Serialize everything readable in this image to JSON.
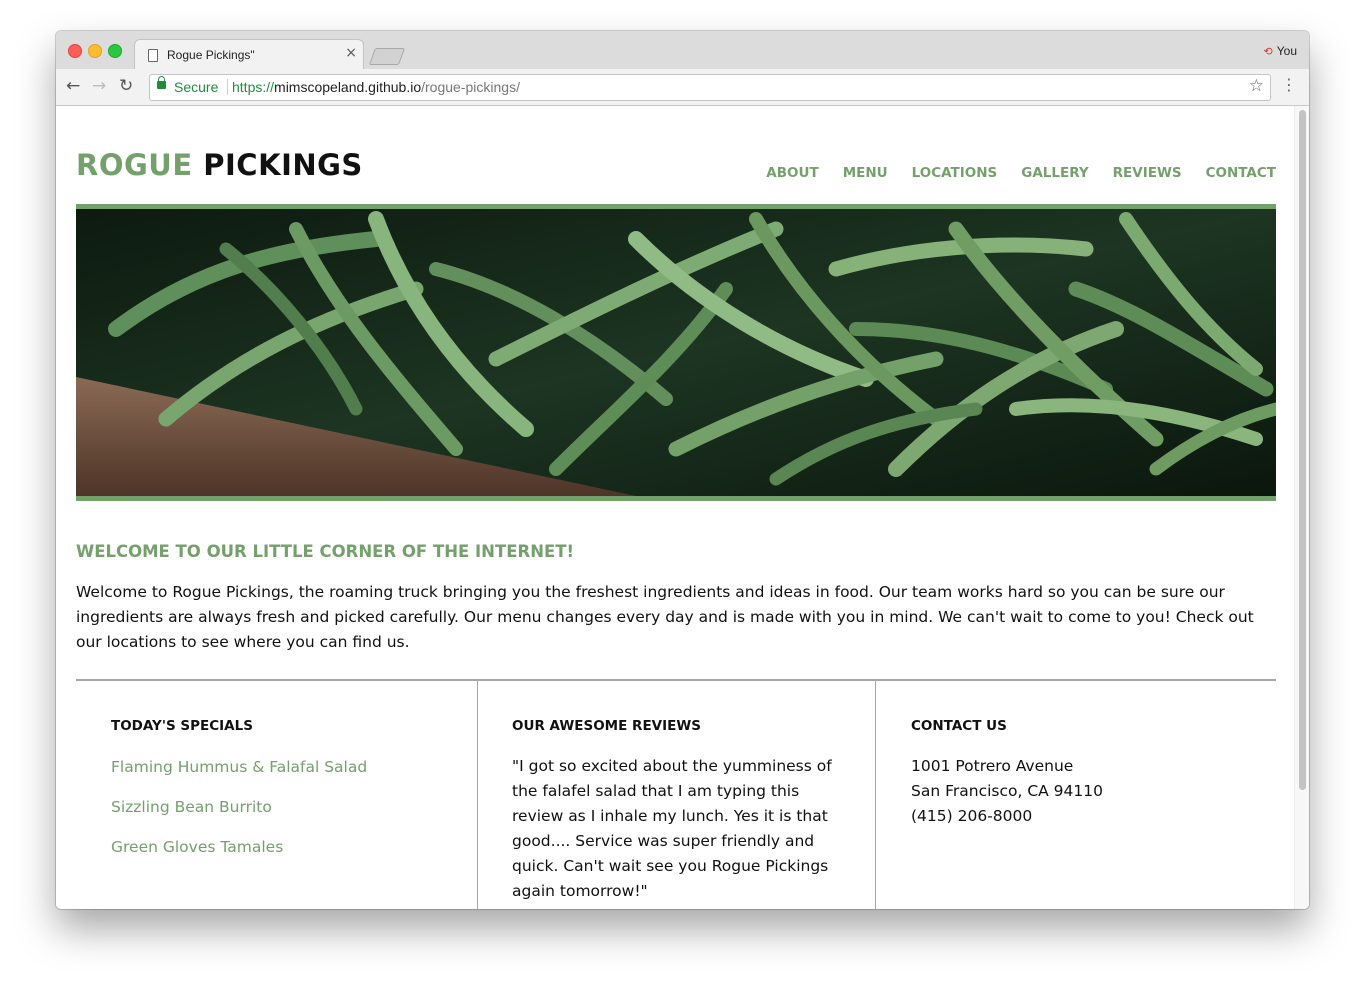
{
  "browser": {
    "tab_title": "Rogue Pickings\"",
    "tab_close": "×",
    "profile": "You",
    "secure_label": "Secure",
    "url_scheme": "https://",
    "url_host": "mimscopeland.github.io",
    "url_path": "/rogue-pickings/"
  },
  "site": {
    "logo_part1": "ROGUE",
    "logo_part2": "PICKINGS",
    "nav": [
      "ABOUT",
      "MENU",
      "LOCATIONS",
      "GALLERY",
      "REVIEWS",
      "CONTACT"
    ],
    "accent_color": "#74a06c"
  },
  "welcome": {
    "title": "WELCOME TO OUR LITTLE CORNER OF THE INTERNET!",
    "body": "Welcome to Rogue Pickings, the roaming truck bringing you the freshest ingredients and ideas in food. Our team works hard so you can be sure our ingredients are always fresh and picked carefully. Our menu changes every day and is made with you in mind. We can't wait to come to you! Check out our locations to see where you can find us."
  },
  "specials": {
    "heading": "TODAY'S SPECIALS",
    "items": [
      "Flaming Hummus & Falafal Salad",
      "Sizzling Bean Burrito",
      "Green Gloves Tamales"
    ]
  },
  "reviews": {
    "heading": "OUR AWESOME REVIEWS",
    "text": "\"I got so excited about the yumminess of the falafel salad that I am typing this review as I inhale my lunch. Yes it is that good.... Service was super friendly and quick. Can't wait see you Rogue Pickings again tomorrow!\""
  },
  "contact": {
    "heading": "CONTACT US",
    "address1": "1001 Potrero Avenue",
    "address2": "San Francisco, CA 94110",
    "phone": "(415) 206-8000"
  }
}
